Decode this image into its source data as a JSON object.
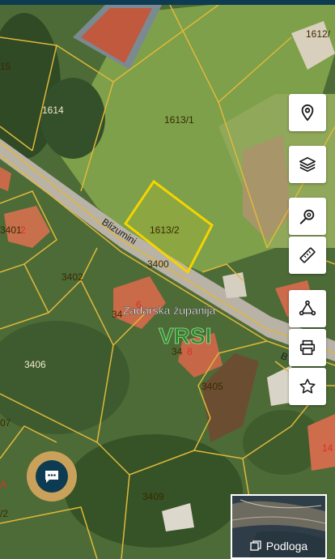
{
  "map": {
    "parcels": {
      "p1612": "1612/",
      "p15": "15",
      "p1614": "1614",
      "p1613_1": "1613/1",
      "p1613_2": "1613/2",
      "p3401": "3401",
      "p2": "2",
      "p3402": "3402",
      "p3400": "3400",
      "p34": "34",
      "p6": "6",
      "p3406": "3406",
      "p8": "8",
      "p348": "34",
      "p3405": "3405",
      "p14": "14",
      "p07": "07",
      "pA": "A",
      "p2slash": "/2",
      "p3409": "3409",
      "p15b": "15"
    },
    "street_label": "Blizumini",
    "street_label_b": "B",
    "county_label": "Zadarska županija",
    "place_label": "VRSI"
  },
  "toolbar": {
    "locate_icon": "map-pin-icon",
    "layers_icon": "layers-icon",
    "search_location_icon": "search-location-icon",
    "measure_icon": "ruler-icon",
    "shape_icon": "polygon-icon",
    "print_icon": "print-icon",
    "favorite_icon": "star-icon"
  },
  "chat": {
    "icon": "chat-bubble-icon"
  },
  "basemap": {
    "label": "Podloga",
    "icon": "basemap-icon"
  },
  "colors": {
    "parcel_line": "#e0b83a",
    "selected_parcel": "#f5d400",
    "header": "#0d3b52",
    "chat_ring": "#caa15b"
  }
}
